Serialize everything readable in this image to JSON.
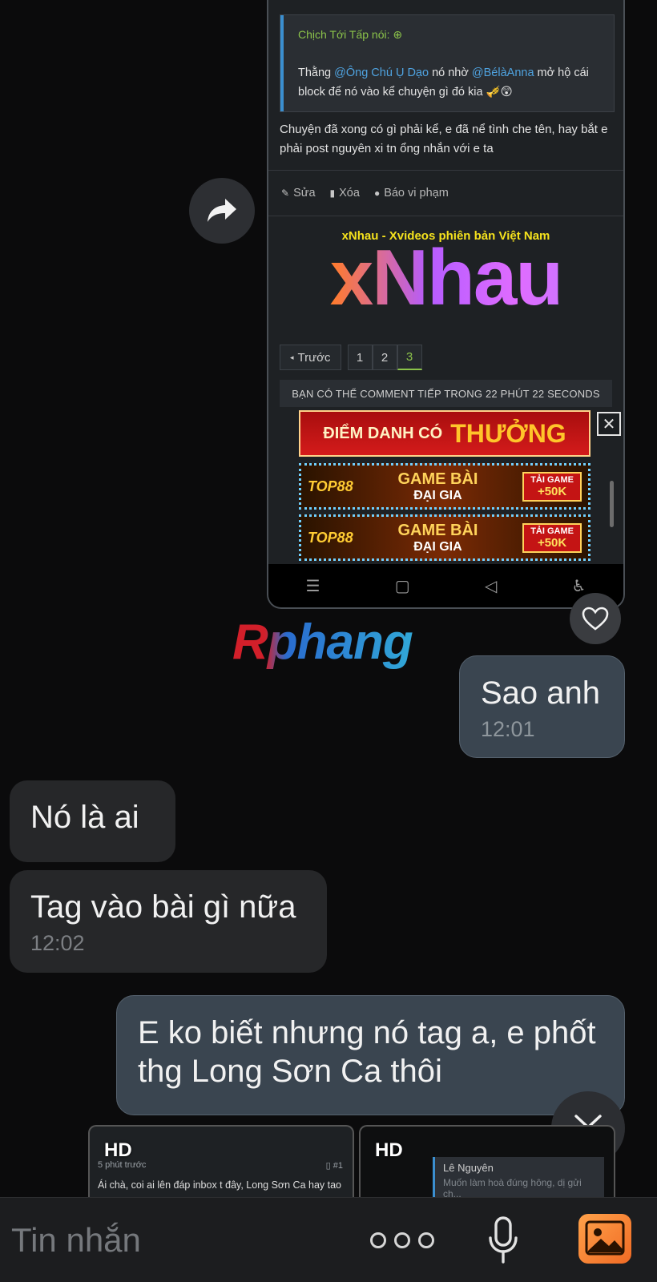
{
  "screenshot": {
    "quote_author": "Chịch Tới Tấp nói:",
    "quote_pre": "Thằng ",
    "quote_mention1": "@Ông Chú Ụ Dạo",
    "quote_mid": " nó nhờ ",
    "quote_mention2": "@BélàAnna",
    "quote_post": " mở hộ cái block để nó vào kể chuyện gì đó kia",
    "post_body": "Chuyện đã xong có gì phải kể, e đã nể tình che tên, hay bắt e phải post nguyên xi tn ổng nhắn với e ta",
    "actions": {
      "edit": "Sửa",
      "delete": "Xóa",
      "report": "Báo vi phạm"
    },
    "ad_title": "xNhau - Xvideos phiên bản Việt Nam",
    "ad_logo": "xNhau",
    "pager": {
      "prev": "Trước",
      "pages": [
        "1",
        "2",
        "3"
      ],
      "current": "3"
    },
    "notice": "BẠN CÓ THỂ COMMENT TIẾP TRONG 22 PHÚT 22 SECONDS",
    "banner1": {
      "line1": "ĐIỂM DANH CÓ",
      "line2": "THƯỞNG"
    },
    "banner_game": {
      "brand": "TOP88",
      "title1": "GAME BÀI",
      "title2": "ĐẠI GIA",
      "cta1": "TẢI GAME",
      "cta2": "+50K"
    },
    "close_label": "✕"
  },
  "watermark": "Rphang",
  "messages": [
    {
      "direction": "out",
      "text": "Sao anh",
      "time": "12:01"
    },
    {
      "direction": "in",
      "text": "Nó là ai",
      "time": ""
    },
    {
      "direction": "in",
      "text": "Tag vào bài gì nữa",
      "time": "12:02"
    },
    {
      "direction": "out",
      "text": "E ko biết nhưng nó tag a, e phốt thg Long Sơn Ca thôi",
      "time": ""
    }
  ],
  "attachments": [
    {
      "badge": "HD",
      "time": "5 phút trước",
      "num": "#1",
      "text": "Ái chà, coi ai lên đáp inbox t đây, Long Sơn Ca hay tao"
    },
    {
      "badge": "HD",
      "name": "Lê Nguyên",
      "text": "Muốn làm hoà đúng hông, dị gửi ch..."
    }
  ],
  "composer": {
    "placeholder": "Tin nhắn"
  },
  "colors": {
    "accent_green": "#8bc34a",
    "link_blue": "#4fa3e0",
    "outgoing_bubble": "#3a4550",
    "incoming_bubble": "#262729"
  }
}
